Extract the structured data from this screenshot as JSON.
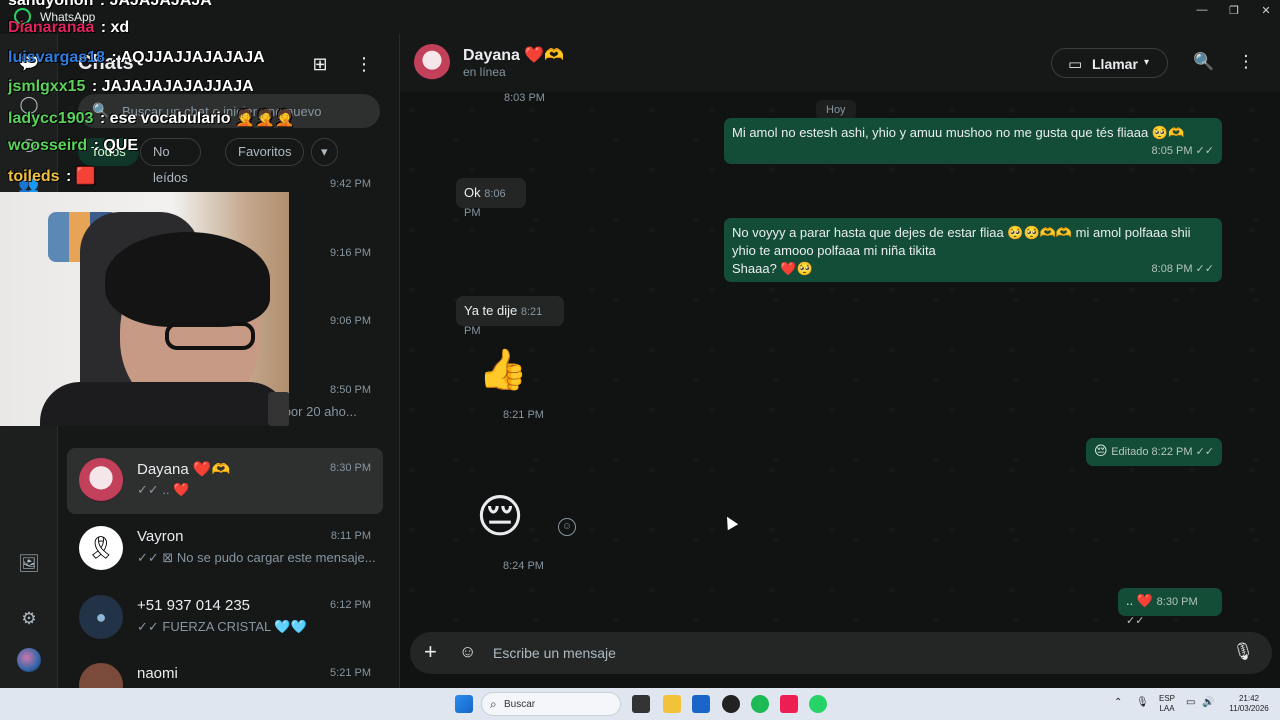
{
  "window": {
    "title": "WhatsApp",
    "minimize": "—",
    "maximize": "❐",
    "close": "✕"
  },
  "rail": {
    "chats_icon": "💬",
    "status_icon": "◯",
    "channels_icon": "◎",
    "communities_icon": "👥",
    "media_icon": "🖼",
    "settings_icon": "⚙"
  },
  "panel": {
    "title": "Chats",
    "new_chat_icon": "⊞",
    "menu_icon": "⋮",
    "search_placeholder": "Buscar un chat o iniciar uno nuevo",
    "search_icon": "🔍",
    "chips": [
      "Todos",
      "No leídos",
      "Favoritos",
      "▾"
    ]
  },
  "chats": [
    {
      "name": "",
      "time": "9:42 PM",
      "preview": ""
    },
    {
      "name": "",
      "time": "9:16 PM",
      "preview": ""
    },
    {
      "name": "",
      "time": "9:06 PM",
      "preview": ""
    },
    {
      "name": "",
      "time": "8:50 PM",
      "preview": "Ma ya estoy liendo estoy por 20 aho..."
    },
    {
      "name": "Dayana ❤️🫶",
      "time": "8:30 PM",
      "preview": "✓✓ .. ❤️"
    },
    {
      "name": "Vayron",
      "time": "8:11 PM",
      "preview": "✓✓ ⊠ No se pudo cargar este mensaje..."
    },
    {
      "name": "+51 937 014 235",
      "time": "6:12 PM",
      "preview": "✓✓ FUERZA CRISTAL 🩵🩵"
    },
    {
      "name": "naomi",
      "time": "5:21 PM",
      "preview": ""
    }
  ],
  "conversation": {
    "name": "Dayana ❤️🫶",
    "status": "en línea",
    "call_label": "Llamar",
    "call_chevron": "▾",
    "camera_icon": "▭",
    "search_icon": "🔍",
    "menu_icon": "⋮",
    "top_time": "8:03 PM",
    "day_label": "Hoy",
    "messages": [
      {
        "dir": "out",
        "text": "Mi amol no estesh ashi, yhio y amuu mushoo no me gusta que tés fliaaa 🥺🫶",
        "time": "8:05 PM ✓✓"
      },
      {
        "dir": "in",
        "text": "Ok",
        "time": "8:06 PM"
      },
      {
        "dir": "out",
        "text": "No voyyy a parar hasta que dejes de estar fliaa 🥺🥺🫶🫶 mi amol polfaaa shii yhio te amooo polfaaa mi niña tikita",
        "text2": "Shaaa? ❤️🥺",
        "time": "8:08 PM ✓✓"
      },
      {
        "dir": "in",
        "text": "Ya te dije",
        "time": "8:21 PM"
      },
      {
        "dir": "in",
        "emoji": "👍",
        "time": "8:21 PM"
      },
      {
        "dir": "out",
        "text": "😔",
        "time": "Editado 8:22 PM ✓✓"
      },
      {
        "dir": "in",
        "emoji": "😔",
        "time": "8:24 PM",
        "react": "☺"
      },
      {
        "dir": "out",
        "text": ".. ❤️",
        "time": "8:30 PM ✓✓"
      }
    ],
    "compose_placeholder": "Escribe un mensaje",
    "plus_icon": "+",
    "sticker_icon": "☺",
    "mic_icon": "🎙"
  },
  "overlay": {
    "lines": [
      {
        "user": "sandyonon",
        "msg": "JAJAJAJAJA",
        "color": "#ffffff"
      },
      {
        "user": "Dianaranaa",
        "msg": "xd",
        "color": "#e0245e"
      },
      {
        "user": "luisvargas18",
        "msg": "AQJJAJJAJAJAJA",
        "color": "#2f7de1"
      },
      {
        "user": "jsmlgxx15",
        "msg": "JAJAJAJAJAJJAJA",
        "color": "#5bd35b"
      },
      {
        "user": "ladycc1903",
        "msg": "ese vocabulario 🤦🤦🤦",
        "color": "#5bd35b"
      },
      {
        "user": "woosseird",
        "msg": "QUE",
        "color": "#5bd35b"
      },
      {
        "user": "toileds",
        "msg": "🟥",
        "color": "#f0c040"
      }
    ]
  },
  "taskbar": {
    "search_placeholder": "Buscar",
    "lang": "ESP",
    "lang2": "LAA",
    "time": "21:42",
    "date": "11/03/2026"
  }
}
